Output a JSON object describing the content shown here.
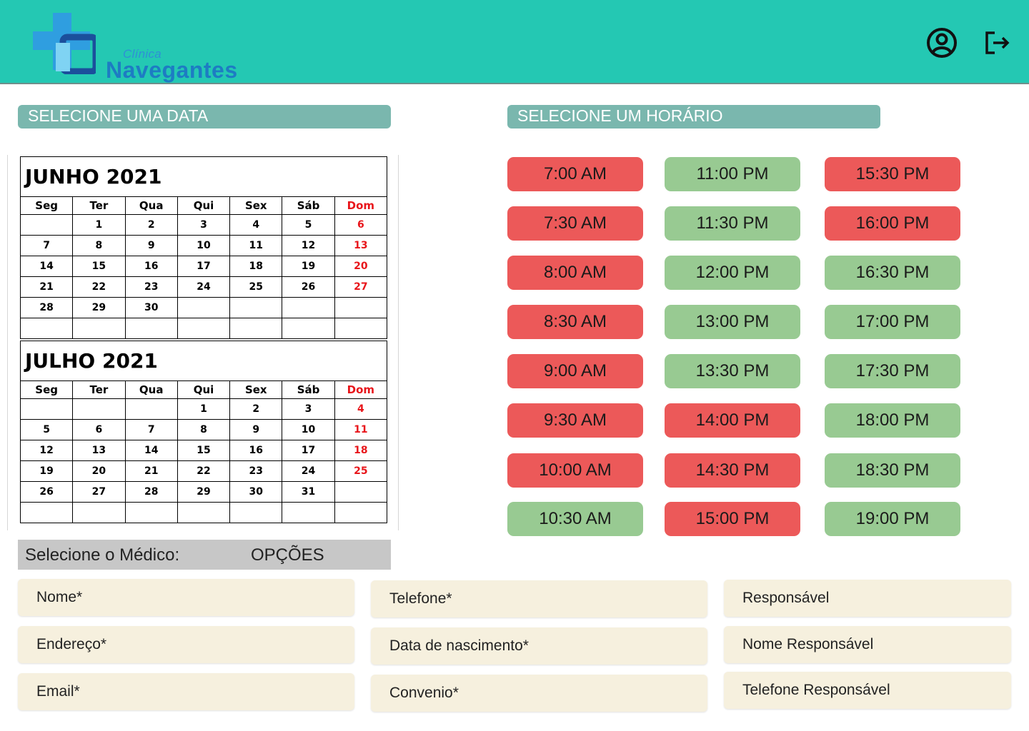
{
  "header": {
    "logo_small": "Clínica",
    "logo_big": "Navegantes",
    "user_icon": "user-circle-icon",
    "logout_icon": "logout-icon"
  },
  "date_section": {
    "title": "SELECIONE UMA DATA"
  },
  "time_section": {
    "title": "SELECIONE UM HORÁRIO"
  },
  "weekdays": [
    "Seg",
    "Ter",
    "Qua",
    "Qui",
    "Sex",
    "Sáb",
    "Dom"
  ],
  "calendars": [
    {
      "month": "JUNHO 2021",
      "weeks": [
        [
          "",
          "1",
          "2",
          "3",
          "4",
          "5",
          "6"
        ],
        [
          "7",
          "8",
          "9",
          "10",
          "11",
          "12",
          "13"
        ],
        [
          "14",
          "15",
          "16",
          "17",
          "18",
          "19",
          "20"
        ],
        [
          "21",
          "22",
          "23",
          "24",
          "25",
          "26",
          "27"
        ],
        [
          "28",
          "29",
          "30",
          "",
          "",
          "",
          ""
        ],
        [
          "",
          "",
          "",
          "",
          "",
          "",
          ""
        ]
      ]
    },
    {
      "month": "JULHO 2021",
      "weeks": [
        [
          "",
          "",
          "",
          "1",
          "2",
          "3",
          "4"
        ],
        [
          "5",
          "6",
          "7",
          "8",
          "9",
          "10",
          "11"
        ],
        [
          "12",
          "13",
          "14",
          "15",
          "16",
          "17",
          "18"
        ],
        [
          "19",
          "20",
          "21",
          "22",
          "23",
          "24",
          "25"
        ],
        [
          "26",
          "27",
          "28",
          "29",
          "30",
          "31",
          ""
        ],
        [
          "",
          "",
          "",
          "",
          "",
          "",
          ""
        ]
      ]
    }
  ],
  "doctor": {
    "label": "Selecione o Médico:",
    "options_label": "OPÇÕES"
  },
  "time_slots": [
    [
      {
        "label": "7:00 AM",
        "status": "busy"
      },
      {
        "label": "7:30 AM",
        "status": "busy"
      },
      {
        "label": "8:00 AM",
        "status": "busy"
      },
      {
        "label": "8:30 AM",
        "status": "busy"
      },
      {
        "label": "9:00 AM",
        "status": "busy"
      },
      {
        "label": "9:30 AM",
        "status": "busy"
      },
      {
        "label": "10:00 AM",
        "status": "busy"
      },
      {
        "label": "10:30 AM",
        "status": "free"
      }
    ],
    [
      {
        "label": "11:00 PM",
        "status": "free"
      },
      {
        "label": "11:30 PM",
        "status": "free"
      },
      {
        "label": "12:00 PM",
        "status": "free"
      },
      {
        "label": "13:00 PM",
        "status": "free"
      },
      {
        "label": "13:30 PM",
        "status": "free"
      },
      {
        "label": "14:00 PM",
        "status": "busy"
      },
      {
        "label": "14:30 PM",
        "status": "busy"
      },
      {
        "label": "15:00 PM",
        "status": "busy"
      }
    ],
    [
      {
        "label": "15:30 PM",
        "status": "busy"
      },
      {
        "label": "16:00 PM",
        "status": "busy"
      },
      {
        "label": "16:30 PM",
        "status": "free"
      },
      {
        "label": "17:00 PM",
        "status": "free"
      },
      {
        "label": "17:30 PM",
        "status": "free"
      },
      {
        "label": "18:00 PM",
        "status": "free"
      },
      {
        "label": "18:30 PM",
        "status": "free"
      },
      {
        "label": "19:00 PM",
        "status": "free"
      }
    ]
  ],
  "form": {
    "nome": "Nome*",
    "endereco": "Endereço*",
    "email": "Email*",
    "telefone": "Telefone*",
    "nascimento": "Data de nascimento*",
    "convenio": "Convenio*",
    "responsavel": "Responsável",
    "nome_responsavel": "Nome Responsável",
    "telefone_responsavel": "Telefone Responsável"
  },
  "colors": {
    "header": "#24c8b3",
    "section_bar": "#7ab7ae",
    "slot_busy": "#ec5959",
    "slot_free": "#98ca92",
    "sunday": "#e8161b",
    "field_bg": "#f6f0de"
  }
}
